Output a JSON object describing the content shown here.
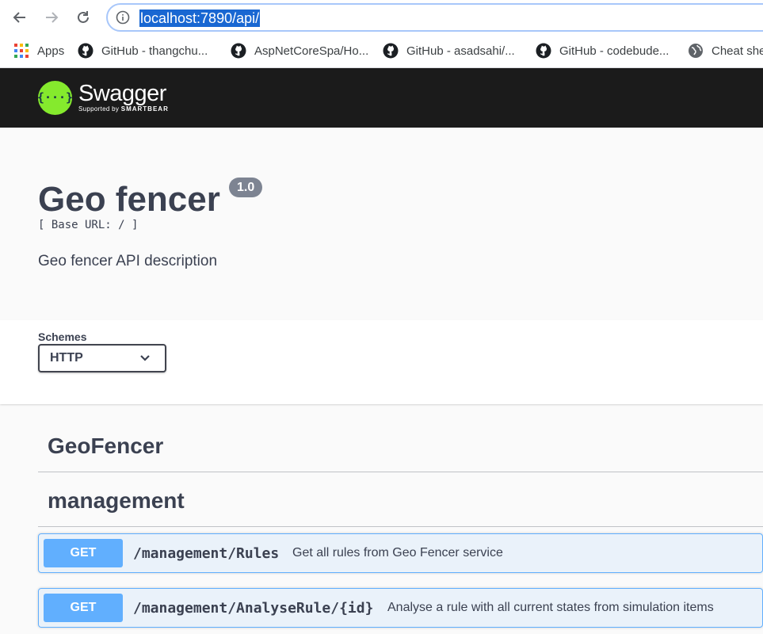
{
  "browser": {
    "url": "localhost:7890/api/",
    "bookmarks": [
      {
        "label": "Apps",
        "icon": "apps-grid-icon"
      },
      {
        "label": "GitHub - thangchu...",
        "icon": "github-icon"
      },
      {
        "label": "AspNetCoreSpa/Ho...",
        "icon": "github-icon"
      },
      {
        "label": "GitHub - asadsahi/...",
        "icon": "github-icon"
      },
      {
        "label": "GitHub - codebude...",
        "icon": "github-icon"
      },
      {
        "label": "Cheat she",
        "icon": "globe-icon"
      }
    ]
  },
  "topbar": {
    "logo_text": "Swagger",
    "logo_sub_prefix": "Supported by",
    "logo_sub_brand": "SMARTBEAR",
    "logo_glyph": "{···}",
    "brand_color": "#85ea2d"
  },
  "info": {
    "title": "Geo fencer",
    "version": "1.0",
    "base_url": "[ Base URL: / ]",
    "description": "Geo fencer API description"
  },
  "schemes": {
    "label": "Schemes",
    "selected": "HTTP"
  },
  "tags": [
    {
      "name": "GeoFencer"
    },
    {
      "name": "management"
    }
  ],
  "operations": [
    {
      "method": "GET",
      "path": "/management/Rules",
      "summary": "Get all rules from Geo Fencer service"
    },
    {
      "method": "GET",
      "path": "/management/AnalyseRule/{id}",
      "summary": "Analyse a rule with all current states from simulation items"
    }
  ],
  "colors": {
    "get_method": "#61affe",
    "text": "#3b4151",
    "topbar": "#1b1b1b"
  }
}
